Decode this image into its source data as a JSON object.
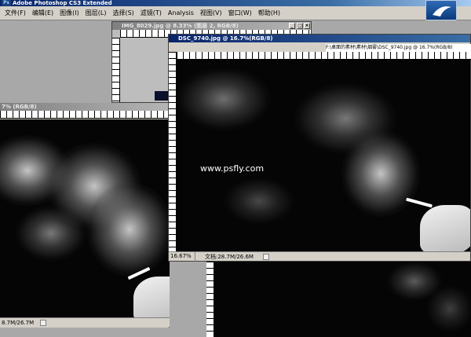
{
  "app": {
    "title": "Adobe Photoshop CS3 Extended",
    "ps_badge": "Ps"
  },
  "menu": [
    "文件(F)",
    "编辑(E)",
    "图像(I)",
    "图层(L)",
    "选择(S)",
    "滤镜(T)",
    "Analysis",
    "视图(V)",
    "窗口(W)",
    "帮助(H)"
  ],
  "doc_small": {
    "title": "IMG_8029.jpg @ 8.33% (图层 2, RGB/8)"
  },
  "doc_left": {
    "title_fragment": "7% (RGB/8)",
    "status_info": "8.7M/26.7M"
  },
  "doc_main": {
    "title": "DSC_9740.jpg @ 16.7%(RGB/8)",
    "path_title": "F:\\桌面的素材\\素材\\烟雾\\DSC_9740.jpg @ 16.7%(RGB/8)",
    "zoom": "16.67%",
    "status_info": "文档:28.7M/26.6M"
  },
  "watermark": "www.psfly.com"
}
